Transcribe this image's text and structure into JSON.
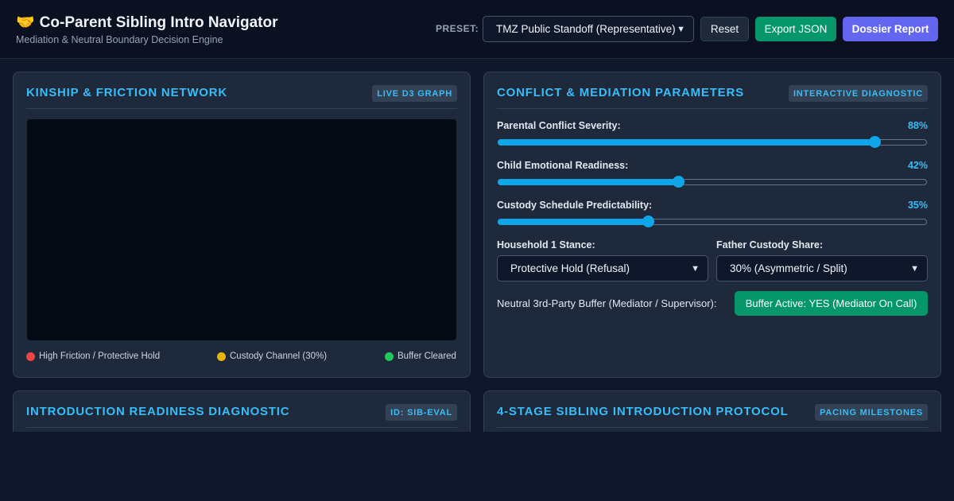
{
  "header": {
    "title": "Co-Parent Sibling Intro Navigator",
    "title_emoji": "🤝",
    "subtitle": "Mediation & Neutral Boundary Decision Engine",
    "preset_label": "PRESET:",
    "preset_value": "TMZ Public Standoff (Representative)",
    "reset_label": "Reset",
    "export_label": "Export JSON",
    "dossier_label": "Dossier Report"
  },
  "network_panel": {
    "title": "KINSHIP & FRICTION NETWORK",
    "badge": "LIVE D3 GRAPH",
    "legend": [
      {
        "label": "High Friction / Protective Hold",
        "color": "#ef4444"
      },
      {
        "label": "Custody Channel (30%)",
        "color": "#eab308"
      },
      {
        "label": "Buffer Cleared",
        "color": "#22c55e"
      }
    ]
  },
  "params_panel": {
    "title": "CONFLICT & MEDIATION PARAMETERS",
    "badge": "INTERACTIVE DIAGNOSTIC",
    "sliders": [
      {
        "label": "Parental Conflict Severity:",
        "value": 88,
        "display": "88%"
      },
      {
        "label": "Child Emotional Readiness:",
        "value": 42,
        "display": "42%"
      },
      {
        "label": "Custody Schedule Predictability:",
        "value": 35,
        "display": "35%"
      }
    ],
    "household_label": "Household 1 Stance:",
    "household_value": "Protective Hold (Refusal)",
    "custody_label": "Father Custody Share:",
    "custody_value": "30% (Asymmetric / Split)",
    "buffer_label": "Neutral 3rd-Party Buffer (Mediator / Supervisor):",
    "buffer_button": "Buffer Active: YES (Mediator On Call)"
  },
  "readiness_panel": {
    "title": "INTRODUCTION READINESS DIAGNOSTIC",
    "badge": "ID: SIB-EVAL"
  },
  "protocol_panel": {
    "title": "4-STAGE SIBLING INTRODUCTION PROTOCOL",
    "badge": "PACING MILESTONES"
  },
  "colors": {
    "accent": "#38bdf8",
    "export": "#059669",
    "dossier": "#6366f1",
    "background": "#0f172a"
  }
}
